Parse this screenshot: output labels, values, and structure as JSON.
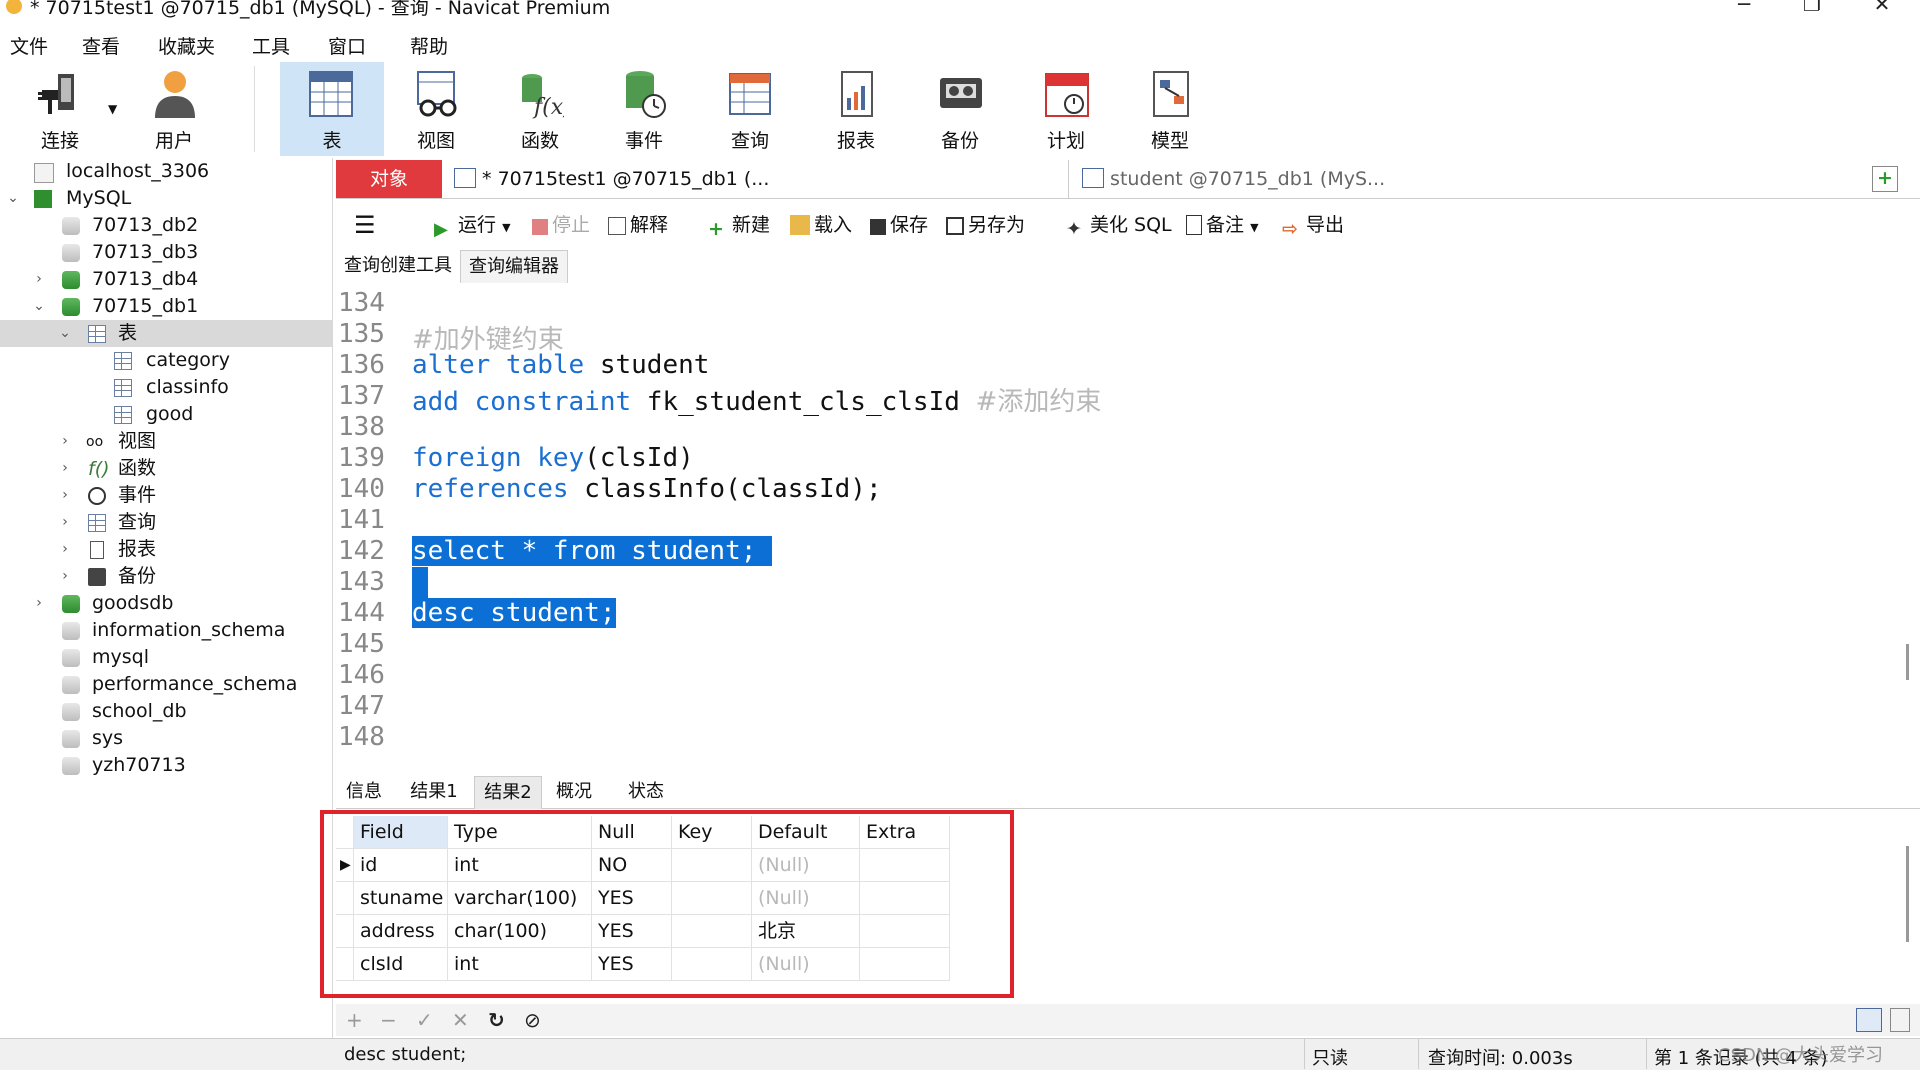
{
  "window": {
    "title": "* 70715test1 @70715_db1 (MySQL) - 查询 - Navicat Premium"
  },
  "menu": [
    "文件",
    "查看",
    "收藏夹",
    "工具",
    "窗口",
    "帮助"
  ],
  "toolbar": [
    {
      "label": "连接",
      "icon": "connection-plug-icon"
    },
    {
      "label": "用户",
      "icon": "user-icon"
    },
    {
      "label": "表",
      "icon": "table-icon"
    },
    {
      "label": "视图",
      "icon": "view-glasses-icon"
    },
    {
      "label": "函数",
      "icon": "function-icon"
    },
    {
      "label": "事件",
      "icon": "event-clock-icon"
    },
    {
      "label": "查询",
      "icon": "query-icon"
    },
    {
      "label": "报表",
      "icon": "report-icon"
    },
    {
      "label": "备份",
      "icon": "backup-tape-icon"
    },
    {
      "label": "计划",
      "icon": "calendar-icon"
    },
    {
      "label": "模型",
      "icon": "model-icon"
    }
  ],
  "sidebar": {
    "items": [
      {
        "label": "localhost_3306"
      },
      {
        "label": "MySQL"
      },
      {
        "label": "70713_db2"
      },
      {
        "label": "70713_db3"
      },
      {
        "label": "70713_db4"
      },
      {
        "label": "70715_db1"
      },
      {
        "label": "表"
      },
      {
        "label": "category"
      },
      {
        "label": "classinfo"
      },
      {
        "label": "good"
      },
      {
        "label": "视图"
      },
      {
        "label": "函数"
      },
      {
        "label": "事件"
      },
      {
        "label": "查询"
      },
      {
        "label": "报表"
      },
      {
        "label": "备份"
      },
      {
        "label": "goodsdb"
      },
      {
        "label": "information_schema"
      },
      {
        "label": "mysql"
      },
      {
        "label": "performance_schema"
      },
      {
        "label": "school_db"
      },
      {
        "label": "sys"
      },
      {
        "label": "yzh70713"
      }
    ]
  },
  "tabs": {
    "objects": "对象",
    "doc1": "* 70715test1 @70715_db1 (...",
    "doc2": "student @70715_db1 (MyS..."
  },
  "query_toolbar": {
    "run": "运行",
    "stop": "停止",
    "explain": "解释",
    "new": "新建",
    "load": "载入",
    "save": "保存",
    "save_as": "另存为",
    "beautify": "美化 SQL",
    "comment": "备注",
    "export": "导出"
  },
  "subtabs": [
    "查询创建工具",
    "查询编辑器"
  ],
  "editor": {
    "line_numbers": [
      "134",
      "135",
      "136",
      "137",
      "138",
      "139",
      "140",
      "141",
      "142",
      "143",
      "144",
      "145",
      "146",
      "147",
      "148"
    ],
    "l135_comment": "#加外键约束",
    "l136_kw": "alter table",
    "l136_rest": " student",
    "l137_kw": "add constraint",
    "l137_rest": " fk_student_cls_clsId ",
    "l137_comment": "#添加约束",
    "l139_kw": "foreign key",
    "l139_rest": "(clsId)",
    "l140_kw": "references",
    "l140_rest": " classInfo(classId);",
    "l142": "select * from student;",
    "l144": "desc student;"
  },
  "result_tabs": [
    "信息",
    "结果1",
    "结果2",
    "概况",
    "状态"
  ],
  "grid": {
    "columns": [
      "Field",
      "Type",
      "Null",
      "Key",
      "Default",
      "Extra"
    ],
    "rows": [
      [
        "id",
        "int",
        "NO",
        "",
        "(Null)",
        ""
      ],
      [
        "stuname",
        "varchar(100)",
        "YES",
        "",
        "(Null)",
        ""
      ],
      [
        "address",
        "char(100)",
        "YES",
        "",
        "北京",
        ""
      ],
      [
        "clsId",
        "int",
        "YES",
        "",
        "(Null)",
        ""
      ]
    ]
  },
  "statusbar": {
    "sql": "desc student;",
    "readonly": "只读",
    "query_time": "查询时间: 0.003s",
    "records": "第 1 条记录 (共 4 条)",
    "watermark": "CSDN @大头爱学习"
  },
  "colors": {
    "accent": "#e03a3e",
    "selection": "#0b6fd6",
    "keyword": "#1a6fd1",
    "highlight_box": "#e0222a"
  }
}
